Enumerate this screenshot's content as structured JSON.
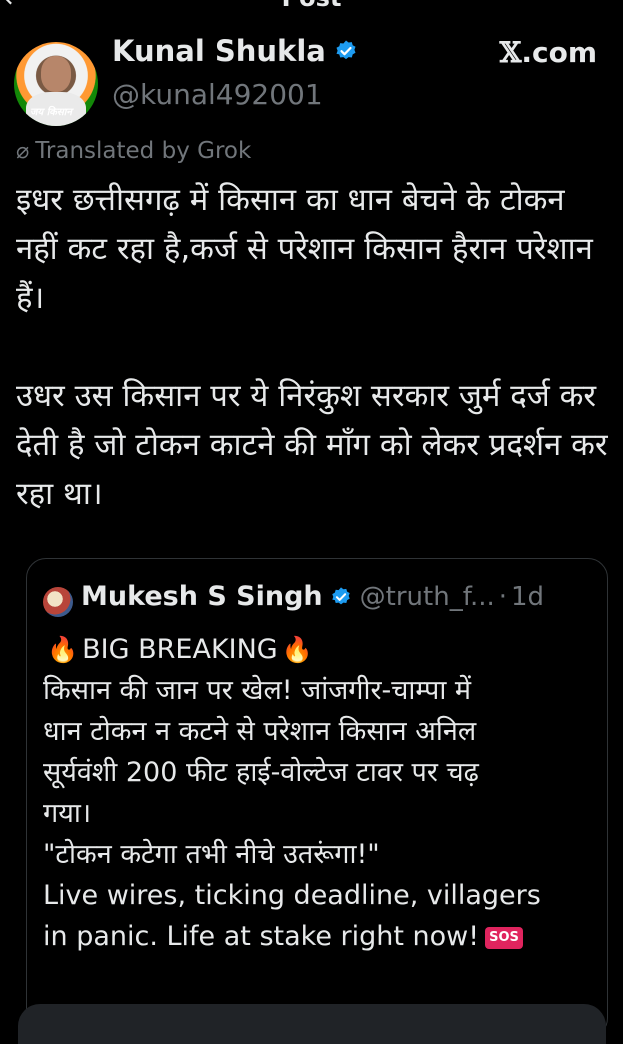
{
  "header": {
    "title": "Post",
    "back_icon": "arrow-left-icon"
  },
  "author": {
    "name": "Kunal Shukla",
    "handle": "@kunal492001",
    "avatar_text": "जय किसान",
    "verified_color": "#1d9bf0"
  },
  "source": {
    "label": "X.com",
    "x_glyph": "𝕏",
    "suffix": ".com"
  },
  "translation": {
    "label": "Translated by Grok",
    "icon": "slash-circle-icon"
  },
  "post": {
    "text": "इधर छत्तीसगढ़ में किसान का धान बेचने के टोकन नहीं कट रहा है,कर्ज से परेशान किसान हैरान परेशान हैं।\n\nउधर उस किसान पर ये निरंकुश सरकार जुर्म दर्ज कर देती है जो टोकन काटने की माँग को लेकर प्रदर्शन कर रहा था।"
  },
  "quote": {
    "author_name": "Mukesh S Singh",
    "handle": "@truth_f...",
    "dot": "·",
    "time": "1d",
    "headline": "BIG BREAKING",
    "lines": [
      "किसान की जान पर खेल! जांजगीर-चाम्पा में",
      "धान टोकन न कटने से परेशान किसान अनिल",
      "सूर्यवंशी 200 फीट हाई-वोल्टेज टावर पर चढ़",
      "गया।",
      "\"टोकन कटेगा तभी नीचे उतरूंगा!\"",
      "Live wires, ticking deadline, villagers",
      "in panic. Life at stake right now!"
    ],
    "sos_label": "SOS",
    "fire_icon": "🔥"
  },
  "colors": {
    "background": "#000000",
    "text": "#e7e9ea",
    "muted": "#71767b",
    "accent": "#1d9bf0",
    "border": "#2f3336"
  }
}
